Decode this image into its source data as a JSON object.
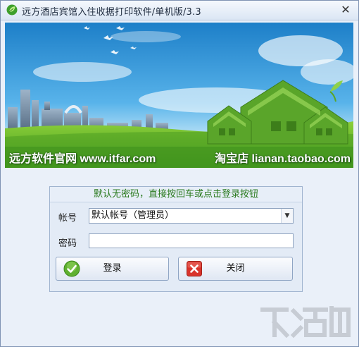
{
  "window": {
    "title": "远方酒店宾馆入住收据打印软件/单机版/3.3",
    "close_glyph": "✕"
  },
  "banner": {
    "left_text": "远方软件官网 www.itfar.com",
    "right_text": "淘宝店 lianan.taobao.com"
  },
  "login": {
    "hint": "默认无密码，直接按回车或点击登录按钮",
    "account_label": "帐号",
    "account_value": "默认帐号（管理员）",
    "password_label": "密码",
    "password_value": "",
    "login_label": "登录",
    "close_label": "关闭"
  },
  "icons": {
    "app": "leaf-icon",
    "login": "check-circle-icon",
    "close": "red-x-icon",
    "dropdown": "chevron-down-icon"
  },
  "colors": {
    "hint_text": "#2a7a1e",
    "login_icon": "#5fb030",
    "close_icon": "#d9332b"
  }
}
